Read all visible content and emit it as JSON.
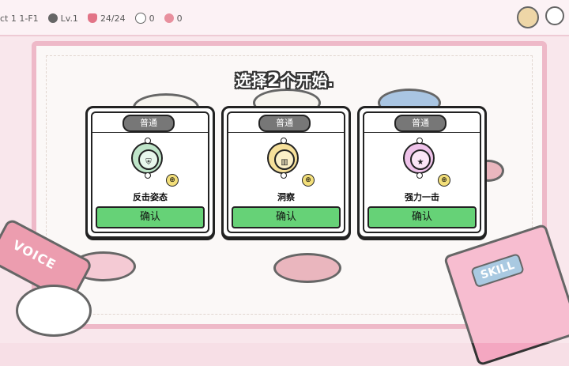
{
  "hud": {
    "act": "ct 1 1-F1",
    "level": "Lv.1",
    "hp": "24/24",
    "coins": "0",
    "pig": "0"
  },
  "prompt": {
    "text_before": "选择",
    "number": "2",
    "text_after": "个开始."
  },
  "decor": {
    "voice_label": "VOICE",
    "skill_label": "SKILL"
  },
  "cards": [
    {
      "rarity": "普通",
      "title": "反击姿态",
      "confirm": "确认",
      "icon": "shield-icon",
      "color": "#bfe5c9"
    },
    {
      "rarity": "普通",
      "title": "洞察",
      "confirm": "确认",
      "icon": "cards-icon",
      "color": "#f6e09a"
    },
    {
      "rarity": "普通",
      "title": "强力一击",
      "confirm": "确认",
      "icon": "star-icon",
      "color": "#efc3ea"
    }
  ],
  "colors": {
    "confirm": "#66d277",
    "badge": "#777777",
    "frame": "#e9a2b6"
  }
}
